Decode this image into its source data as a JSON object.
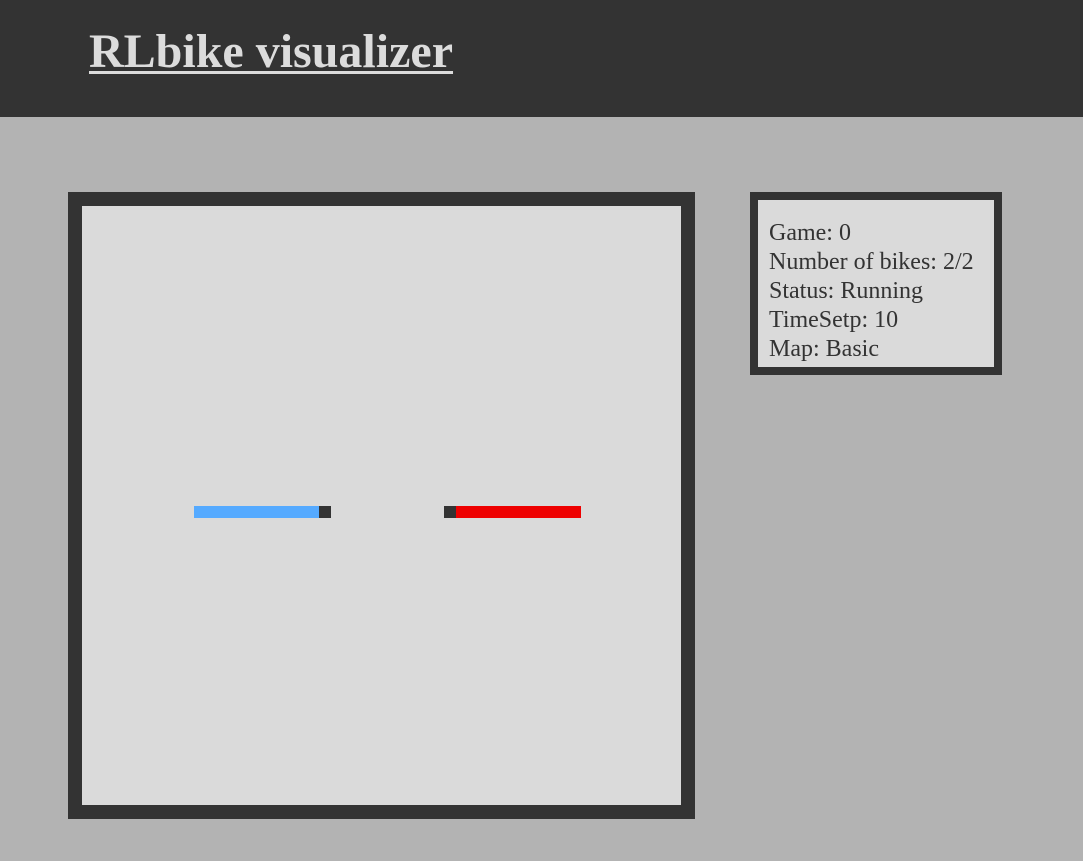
{
  "header": {
    "title": "RLbike visualizer"
  },
  "game": {
    "bikes": [
      {
        "name": "blue-bike",
        "color": "#55aaff",
        "head_color": "#333333",
        "direction": "right"
      },
      {
        "name": "red-bike",
        "color": "#ee0000",
        "head_color": "#333333",
        "direction": "left"
      }
    ]
  },
  "info": {
    "game": "Game: 0",
    "bikes": "Number of bikes: 2/2",
    "status": "Status: Running",
    "timestep": "TimeSetp: 10",
    "map": "Map: Basic"
  },
  "colors": {
    "header_bg": "#333333",
    "page_bg": "#b3b3b3",
    "field_bg": "#dadada",
    "border": "#333333",
    "title_text": "#dcdcdc"
  }
}
